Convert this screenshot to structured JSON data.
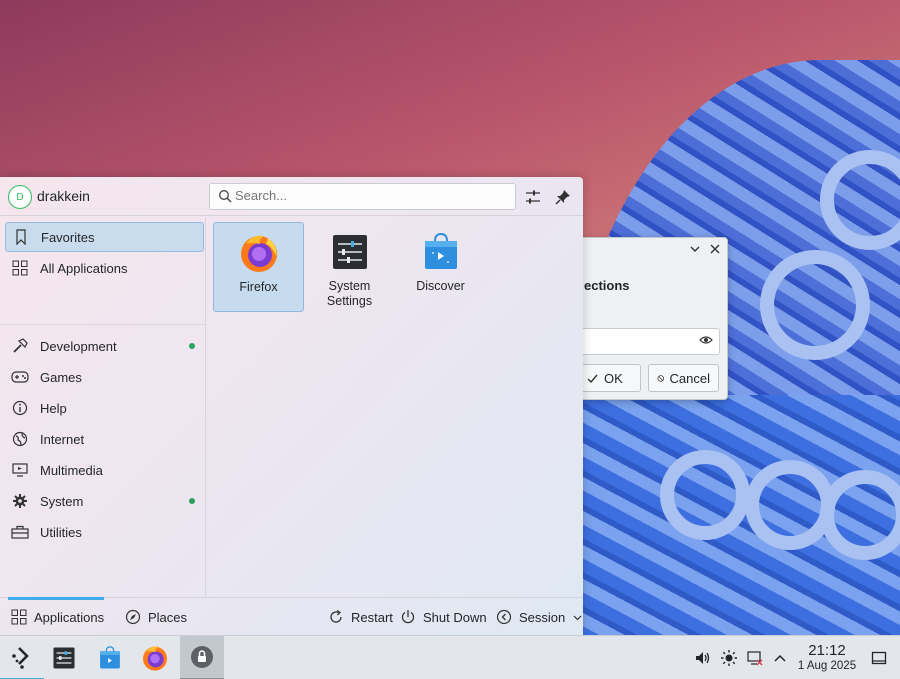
{
  "dialog": {
    "title_fragment": "ections",
    "ok_label": "OK",
    "cancel_label": "Cancel"
  },
  "launcher": {
    "user": {
      "initial": "D",
      "name": "drakkein"
    },
    "search": {
      "placeholder": "Search..."
    },
    "categories": [
      {
        "label": "Favorites",
        "icon": "bookmark-icon",
        "selected": true
      },
      {
        "label": "All Applications",
        "icon": "grid-icon"
      },
      {
        "label": "Development",
        "icon": "hammer-icon",
        "new": true
      },
      {
        "label": "Games",
        "icon": "gamepad-icon"
      },
      {
        "label": "Help",
        "icon": "info-icon"
      },
      {
        "label": "Internet",
        "icon": "globe-icon"
      },
      {
        "label": "Multimedia",
        "icon": "monitor-icon"
      },
      {
        "label": "System",
        "icon": "gear-icon",
        "new": true
      },
      {
        "label": "Utilities",
        "icon": "toolbox-icon"
      }
    ],
    "apps": [
      {
        "label": "Firefox",
        "icon": "firefox-icon",
        "selected": true
      },
      {
        "label": "System Settings",
        "icon": "settings-icon"
      },
      {
        "label": "Discover",
        "icon": "discover-icon"
      }
    ],
    "footer": {
      "applications": "Applications",
      "places": "Places",
      "restart": "Restart",
      "shutdown": "Shut Down",
      "session": "Session"
    }
  },
  "taskbar": {
    "time": "21:12",
    "date": "1 Aug 2025"
  },
  "colors": {
    "accent": "#3daee9",
    "new_dot": "#27a35a",
    "avatar": "#2fbd5e"
  }
}
